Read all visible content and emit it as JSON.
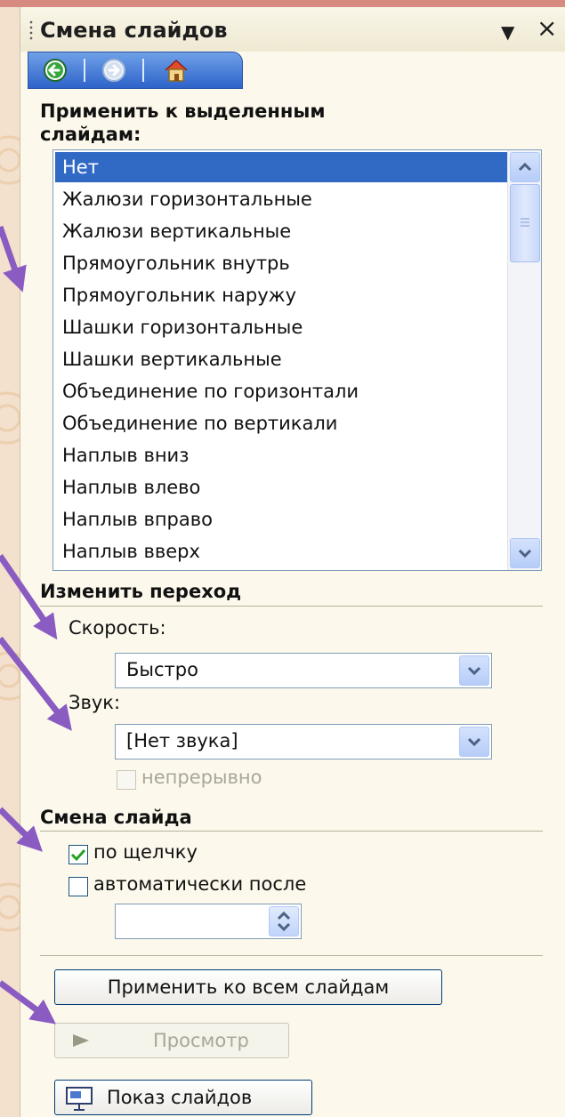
{
  "pane": {
    "title": "Смена слайдов",
    "menu_icon": "dropdown-triangle-icon",
    "close_icon": "close-icon"
  },
  "nav": {
    "icons": [
      "back-icon",
      "forward-icon",
      "home-icon"
    ]
  },
  "apply_section": {
    "label": "Применить к выделенным слайдам:",
    "label_line1": "Применить к выделенным",
    "label_line2": "слайдам:",
    "items": [
      "Нет",
      "Жалюзи горизонтальные",
      "Жалюзи вертикальные",
      "Прямоугольник внутрь",
      "Прямоугольник наружу",
      "Шашки горизонтальные",
      "Шашки вертикальные",
      "Объединение по горизонтали",
      "Объединение по вертикали",
      "Наплыв вниз",
      "Наплыв влево",
      "Наплыв вправо",
      "Наплыв вверх"
    ],
    "selected_index": 0
  },
  "modify": {
    "heading": "Изменить переход",
    "speed_label": "Скорость:",
    "speed_value": "Быстро",
    "sound_label": "Звук:",
    "sound_value": "[Нет звука]",
    "loop_label": "непрерывно",
    "loop_checked": false,
    "loop_enabled": false
  },
  "advance": {
    "heading": "Смена слайда",
    "on_click_label": "по щелчку",
    "on_click_checked": true,
    "auto_label": "автоматически после",
    "auto_checked": false,
    "auto_value": ""
  },
  "buttons": {
    "apply_all": "Применить ко всем слайдам",
    "preview": "Просмотр",
    "preview_enabled": false,
    "slideshow": "Показ слайдов"
  },
  "colors": {
    "selection": "#316ac5",
    "nav_bar": "#3d70d6",
    "annotation_arrow": "#8a5cc2",
    "checkbox_check": "#21a121"
  }
}
